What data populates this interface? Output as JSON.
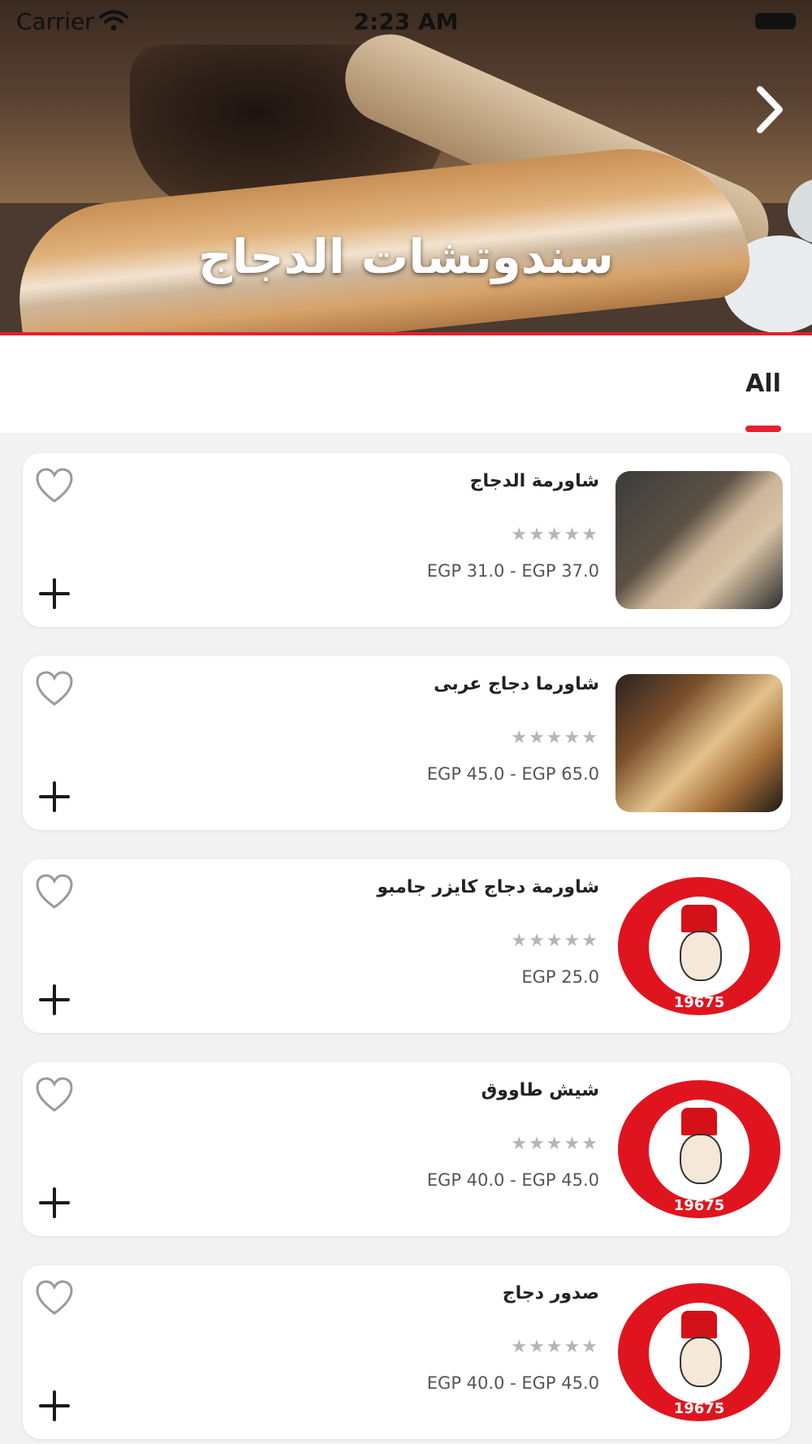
{
  "status_bar": {
    "carrier": "Carrier",
    "time": "2:23 AM"
  },
  "hero": {
    "title": "سندوتشات الدجاج"
  },
  "tabs": [
    {
      "label": "All",
      "selected": true
    }
  ],
  "products": [
    {
      "name": "شاورمة الدجاج",
      "rating": 0,
      "max_rating": 5,
      "price": "EGP 31.0 - EGP 37.0",
      "image": "photo1"
    },
    {
      "name": "شاورما دجاج عربى",
      "rating": 0,
      "max_rating": 5,
      "price": "EGP 45.0 - EGP 65.0",
      "image": "photo2"
    },
    {
      "name": "شاورمة دجاج كايزر جامبو",
      "rating": 0,
      "max_rating": 5,
      "price": "EGP 25.0",
      "image": "logo",
      "logo_number": "19675"
    },
    {
      "name": "شيش  طاووق",
      "rating": 0,
      "max_rating": 5,
      "price": "EGP 40.0 - EGP 45.0",
      "image": "logo",
      "logo_number": "19675"
    },
    {
      "name": "صدور  دجاج",
      "rating": 0,
      "max_rating": 5,
      "price": "EGP 40.0 - EGP 45.0",
      "image": "logo",
      "logo_number": "19675"
    }
  ],
  "colors": {
    "accent": "#e4202c",
    "star": "#b5b5b5",
    "background": "#f2f2f2"
  }
}
